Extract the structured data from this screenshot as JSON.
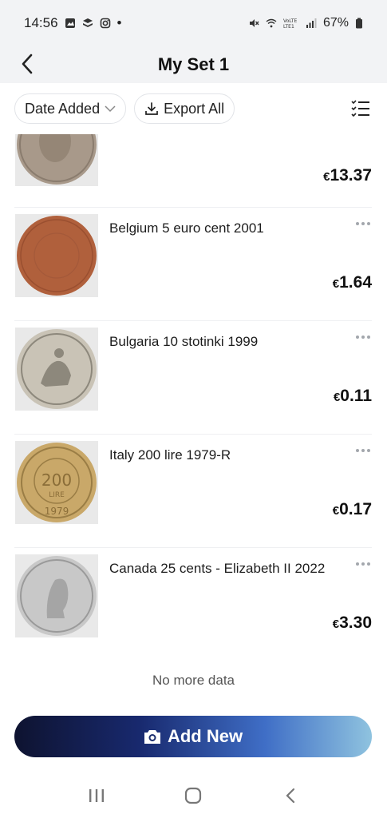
{
  "status_bar": {
    "time": "14:56",
    "dot": "•",
    "battery": "67%",
    "icons": [
      "gallery-icon",
      "stack-icon",
      "instagram-icon",
      "mute-icon",
      "wifi-icon",
      "volte-icon",
      "signal-icon",
      "battery-icon"
    ]
  },
  "header": {
    "title": "My Set 1",
    "back_icon": "chevron-left-icon"
  },
  "toolbar": {
    "sort_label": "Date Added",
    "export_label": "Export All",
    "list_view_icon": "checklist-icon"
  },
  "items": [
    {
      "title": "",
      "currency": "€",
      "price": "13.37",
      "coin_color": "#a8998a"
    },
    {
      "title": "Belgium 5 euro cent 2001",
      "currency": "€",
      "price": "1.64",
      "coin_color": "#b0603c"
    },
    {
      "title": "Bulgaria 10 stotinki 1999",
      "currency": "€",
      "price": "0.11",
      "coin_color": "#c9c3b6"
    },
    {
      "title": "Italy 200 lire 1979-R",
      "currency": "€",
      "price": "0.17",
      "coin_color": "#c9a869"
    },
    {
      "title": "Canada 25 cents - Elizabeth II 2022",
      "currency": "€",
      "price": "3.30",
      "coin_color": "#c8c8c8"
    }
  ],
  "footer": {
    "no_more": "No more data",
    "add_new_label": "Add New",
    "add_new_icon": "camera-icon"
  },
  "nav": {
    "recents_icon": "recents-icon",
    "home_icon": "home-icon",
    "back_icon": "back-icon"
  }
}
